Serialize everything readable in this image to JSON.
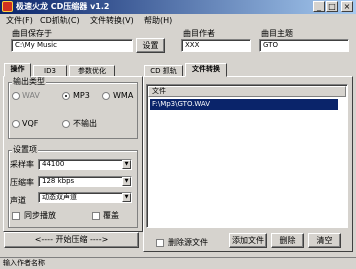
{
  "window": {
    "title": "极速火龙  CD压缩器 v1.2",
    "min_glyph": "_",
    "max_glyph": "□",
    "close_glyph": "×"
  },
  "menu": {
    "items": [
      "文件(F)",
      "CD抓轨(C)",
      "文件转换(V)",
      "帮助(H)"
    ]
  },
  "save": {
    "label": "曲目保存于",
    "path": "C:\\My Music",
    "settings_button": "设置"
  },
  "author": {
    "label": "曲目作者",
    "value": "XXX"
  },
  "subject": {
    "label": "曲目主题",
    "value": "GTO"
  },
  "left_tabs": [
    "操作",
    "ID3",
    "参数优化"
  ],
  "right_tabs": [
    "CD 抓轨",
    "文件转换"
  ],
  "output_type": {
    "title": "输出类型",
    "options": [
      "WAV",
      "MP3",
      "WMA",
      "VQF",
      "不输出"
    ],
    "selected": "MP3"
  },
  "settings": {
    "title": "设置项",
    "sample_rate_label": "采样率",
    "sample_rate_value": "44100",
    "bitrate_label": "压缩率",
    "bitrate_value": "128 kbps",
    "channel_label": "声道",
    "channel_value": "动态双声道",
    "sync_play_label": "同步播放",
    "overwrite_label": "覆盖"
  },
  "start_button": "<---- 开始压缩 ---->",
  "file_list": {
    "header": "文件",
    "rows": [
      "F:\\Mp3\\GTO.WAV"
    ]
  },
  "bottom": {
    "delete_source_label": "删除源文件",
    "add_button": "添加文件",
    "delete_button": "删除",
    "clear_button": "清空"
  },
  "status_text": "输入作者名称"
}
